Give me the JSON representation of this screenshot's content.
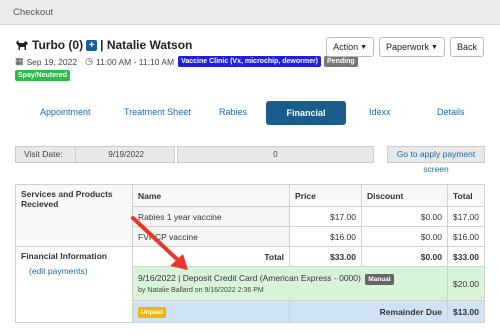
{
  "window": {
    "title": "Checkout"
  },
  "patient": {
    "name": "Turbo (0)",
    "owner": "Natalie Watson",
    "date": "Sep 19, 2022",
    "time": "11:00 AM - 11:10 AM",
    "clinic_badge": "Vaccine Clinic (Vx, microchip, dewormer)",
    "status_badge": "Pending",
    "tag_badge": "Spay/Neutered"
  },
  "actions": {
    "action": "Action",
    "paperwork": "Paperwork",
    "back": "Back"
  },
  "tabs": [
    {
      "label": "Appointment"
    },
    {
      "label": "Treatment Sheet"
    },
    {
      "label": "Rabies"
    },
    {
      "label": "Financial"
    },
    {
      "label": "Idexx"
    },
    {
      "label": "Details"
    }
  ],
  "visit": {
    "label": "Visit Date:",
    "value": "9/19/2022",
    "payment_amount": "0",
    "payment_link": "Go to apply payment screen"
  },
  "table": {
    "headers": {
      "section": "Services and Products Recieved",
      "name": "Name",
      "price": "Price",
      "discount": "Discount",
      "total": "Total"
    },
    "rows": [
      {
        "name": "Rabies 1 year vaccine",
        "price": "$17.00",
        "discount": "$0.00",
        "total": "$17.00"
      },
      {
        "name": "FVRCP vaccine",
        "price": "$16.00",
        "discount": "$0.00",
        "total": "$16.00"
      }
    ],
    "totals": {
      "label": "Total",
      "price": "$33.00",
      "discount": "$0.00",
      "total": "$33.00"
    },
    "financial": {
      "label": "Financial Information",
      "edit": "(edit payments)",
      "deposit": "9/16/2022 | Deposit Credit Card (American Express - 0000)",
      "manual_badge": "Manual",
      "deposit_by": "by Natalie Ballard on 9/16/2022 2:36 PM",
      "deposit_amount": "$20.00",
      "unpaid_badge": "Unpaid",
      "remainder_label": "Remainder Due",
      "remainder_amount": "$13.00"
    }
  },
  "colors": {
    "active_tab": "#1a5d8c",
    "link": "#1a6aa8",
    "annotation_arrow": "#e8372c"
  }
}
